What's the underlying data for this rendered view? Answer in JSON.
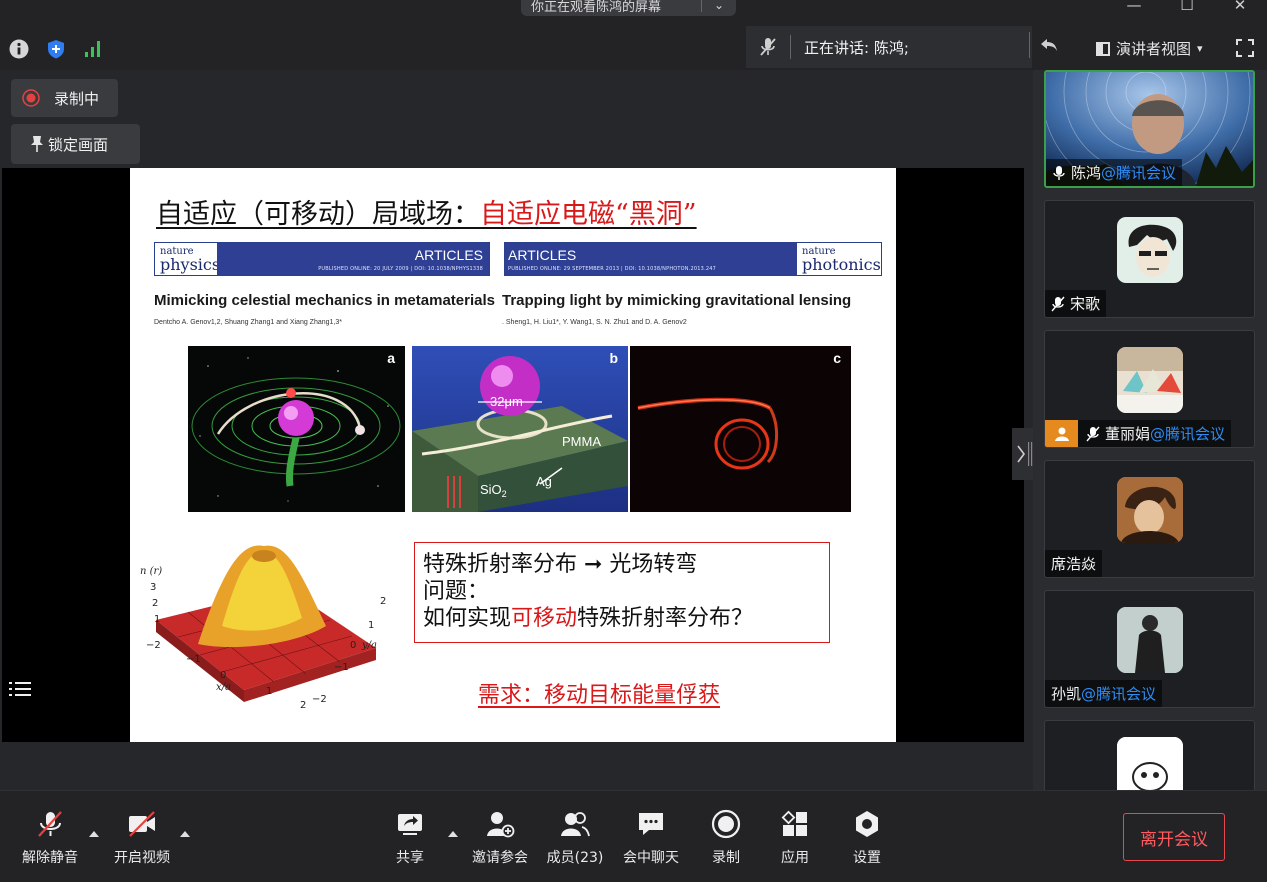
{
  "titlebar": {
    "share_text": "你正在观看陈鸿的屏幕",
    "share_menu_glyph": "⌄",
    "minimize_glyph": "—",
    "maximize_glyph": "☐",
    "close_glyph": "✕"
  },
  "infobar": {
    "speaking_label": "正在讲话: 陈鸿;",
    "view_label": "演讲者视图",
    "view_caret": "▾"
  },
  "stage": {
    "recording_label": "录制中",
    "lock_label": "锁定画面"
  },
  "slide": {
    "title_black": "自适应（可移动）局域场：",
    "title_red": "自适应电磁“黑洞”",
    "paper1": {
      "journal_small": "nature",
      "journal_big": "physics",
      "section": "ARTICLES",
      "published": "PUBLISHED ONLINE: 20 JULY 2009 | DOI: 10.1038/NPHYS1338",
      "title": "Mimicking celestial mechanics in metamaterials",
      "authors": "Dentcho A. Genov1,2, Shuang Zhang1 and Xiang Zhang1,3*"
    },
    "paper2": {
      "journal_small": "nature",
      "journal_big": "photonics",
      "section": "ARTICLES",
      "published": "PUBLISHED ONLINE: 29 SEPTEMBER 2013 | DOI: 10.1038/NPHOTON.2013.247",
      "title": "Trapping light by mimicking gravitational lensing",
      "authors": ". Sheng1, H. Liu1*, Y. Wang1, S. N. Zhu1 and D. A. Genov2"
    },
    "panel_a_label": "a",
    "panel_b_label": "b",
    "panel_c_label": "c",
    "panel_b_size": "32μm",
    "panel_b_pmma": "PMMA",
    "panel_b_ag": "Ag",
    "panel_b_sio2": "SiO",
    "panel_b_sio2_sub": "2",
    "plot": {
      "n_label": "n (r)",
      "x_label": "x/a",
      "y_label": "y/a",
      "z_ticks": [
        "3",
        "2",
        "1"
      ],
      "x_ticks": [
        "−2",
        "−1",
        "0",
        "1",
        "2"
      ],
      "y_ticks": [
        "2",
        "1",
        "0",
        "−1",
        "−2"
      ]
    },
    "box_line1": "特殊折射率分布 ➞ 光场转弯",
    "box_line2": "问题：",
    "box_line3_pre": "如何实现",
    "box_line3_red": "可移动",
    "box_line3_post": "特殊折射率分布？",
    "demand": "需求：移动目标能量俘获"
  },
  "sidebar": {
    "tiles": [
      {
        "name": "陈鸿",
        "tag": "@腾讯会议"
      },
      {
        "name": "宋歌",
        "tag": ""
      },
      {
        "name": "董丽娟",
        "tag": "@腾讯会议"
      },
      {
        "name": "席浩焱",
        "tag": ""
      },
      {
        "name": "孙凯",
        "tag": "@腾讯会议"
      },
      {
        "name": "",
        "tag": ""
      }
    ]
  },
  "toolbar": {
    "unmute": "解除静音",
    "start_video": "开启视频",
    "share": "共享",
    "invite": "邀请参会",
    "members": "成员(23)",
    "chat": "会中聊天",
    "record": "录制",
    "apps": "应用",
    "settings": "设置",
    "leave": "离开会议"
  },
  "colors": {
    "accent_blue": "#2f8cf5",
    "leave_red": "#ff5a5f",
    "slide_red": "#d9181a",
    "active_speaker_green": "#3ba04a"
  }
}
